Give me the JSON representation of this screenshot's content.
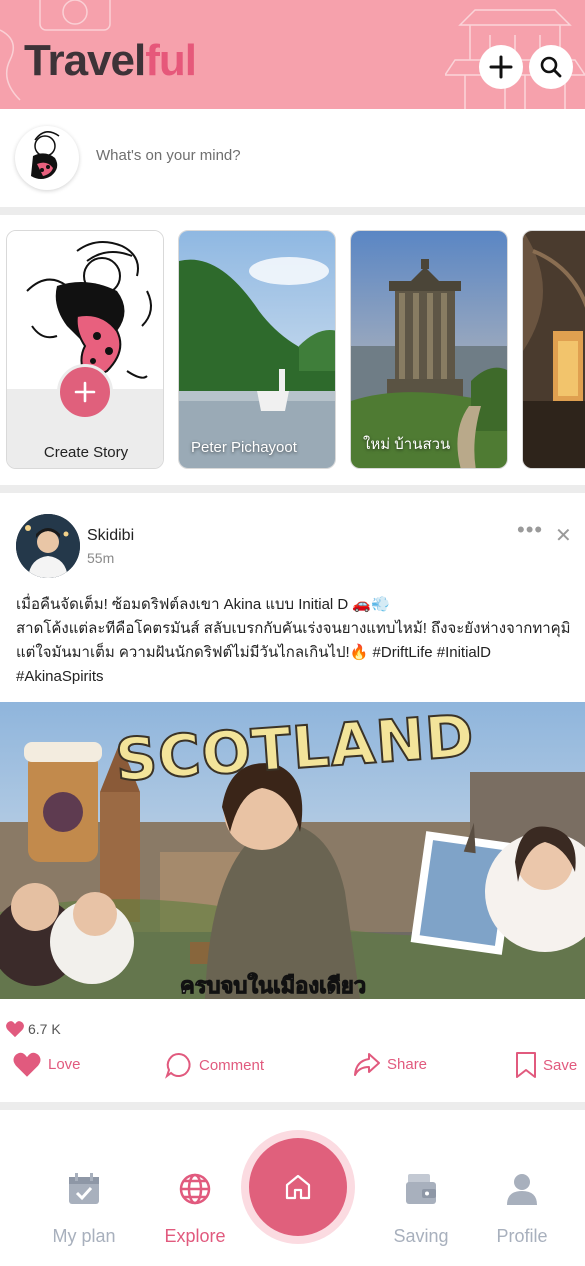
{
  "app": {
    "logo_part1": "Travel",
    "logo_part2": "ful"
  },
  "header": {
    "add_icon": "plus-icon",
    "search_icon": "search-icon"
  },
  "composer": {
    "placeholder": "What's on your mind?"
  },
  "stories": {
    "create_label": "Create Story",
    "items": [
      {
        "label": "Peter Pichayoot"
      },
      {
        "label": "ใหม่ บ้านสวน"
      },
      {
        "label": ""
      }
    ]
  },
  "post": {
    "author": "Skidibi",
    "time": "55m",
    "text": "เมื่อคืนจัดเต็ม! ซ้อมดริฟต์ลงเขา Akina แบบ Initial D 🚗💨\nสาดโค้งแต่ละทีคือโคตรมันส์ สลับเบรกกับคันเร่งจนยางแทบไหม้! ถึงจะยังห่างจากทาคุมิ แต่ใจมันมาเต็ม ความฝันนักดริฟต์ไม่มีวันไกลเกินไป!🔥 #DriftLife #InitialD #AkinaSpirits",
    "image_title": "SCOTLAND",
    "image_caption": "ครบจบในเมืองเดียว",
    "likes": "6.7 K",
    "actions": {
      "love": "Love",
      "comment": "Comment",
      "share": "Share",
      "save": "Save"
    }
  },
  "nav": {
    "my_plan": "My plan",
    "explore": "Explore",
    "saving": "Saving",
    "profile": "Profile"
  },
  "colors": {
    "brand_pink": "#e0607c",
    "header_bg": "#f6a1ac",
    "logo_dark": "#3d3338",
    "inactive": "#a8b0bd"
  }
}
